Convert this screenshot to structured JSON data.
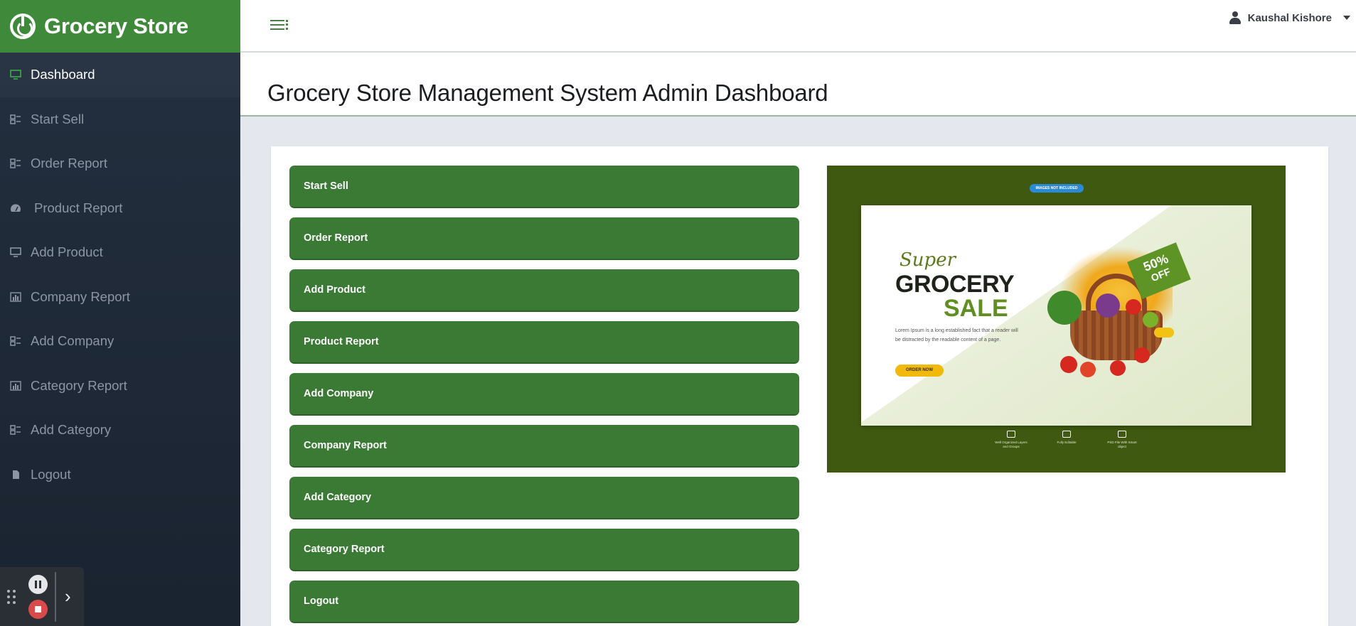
{
  "brand": {
    "title": "Grocery Store",
    "color": "#3f8a3a"
  },
  "sidebar": {
    "items": [
      {
        "label": "Dashboard",
        "icon": "monitor-icon",
        "active": true
      },
      {
        "label": "Start Sell",
        "icon": "grid-list-icon"
      },
      {
        "label": "Order Report",
        "icon": "grid-list-icon"
      },
      {
        "label": "Product Report",
        "icon": "gauge-icon"
      },
      {
        "label": "Add Product",
        "icon": "monitor-icon"
      },
      {
        "label": "Company Report",
        "icon": "bar-chart-icon"
      },
      {
        "label": "Add Company",
        "icon": "grid-list-icon"
      },
      {
        "label": "Category Report",
        "icon": "bar-chart-icon"
      },
      {
        "label": "Add Category",
        "icon": "grid-list-icon"
      },
      {
        "label": "Logout",
        "icon": "file-icon"
      }
    ]
  },
  "topbar": {
    "user_name": "Kaushal Kishore",
    "menu_icon": "hamburger-icon",
    "user_icon": "user-icon"
  },
  "page": {
    "title": "Grocery Store Management System Admin Dashboard"
  },
  "actions": [
    {
      "label": "Start Sell"
    },
    {
      "label": "Order Report"
    },
    {
      "label": "Add Product"
    },
    {
      "label": "Product Report"
    },
    {
      "label": "Add Company"
    },
    {
      "label": "Company Report"
    },
    {
      "label": "Add Category"
    },
    {
      "label": "Category Report"
    },
    {
      "label": "Logout"
    }
  ],
  "banner": {
    "pill": "IMAGES NOT INCLUDED",
    "super": "Super",
    "headline1": "GROCERY",
    "headline2": "SALE",
    "body": "Lorem Ipsum is a long established fact that a reader will be distracted by the readable content of a page.",
    "cta": "ORDER NOW",
    "discount_pct": "50%",
    "discount_off": "OFF",
    "features": [
      {
        "text": "Well Organized Layers and Groups"
      },
      {
        "text": "Fully Editable"
      },
      {
        "text": "PSD File With Smart object"
      }
    ],
    "bg_color": "#3f5a10"
  },
  "colors": {
    "accent": "#3a7a34",
    "sidebar_bg": "#1f2a37"
  }
}
